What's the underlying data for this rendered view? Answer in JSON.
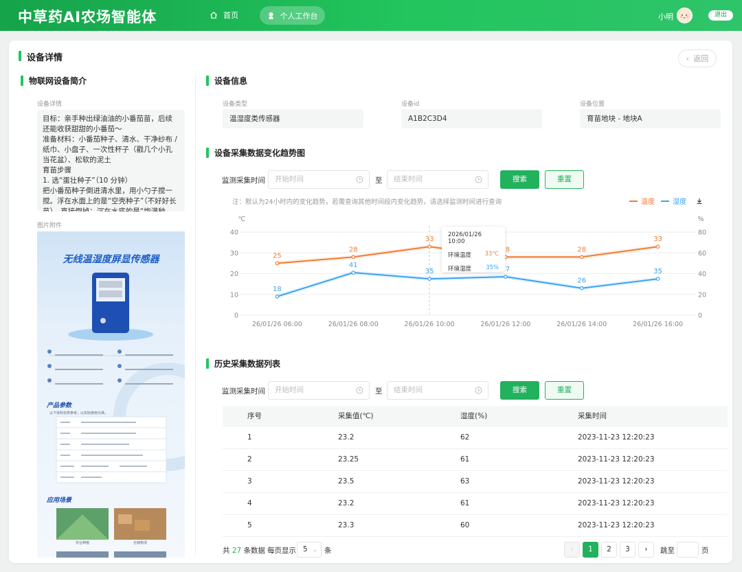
{
  "header": {
    "brand": "中草药AI农场智能体",
    "nav": {
      "home": "首页",
      "workspace": "个人工作台"
    },
    "user_name": "小明",
    "logout": "退出"
  },
  "page": {
    "title": "设备详情",
    "back": "返回"
  },
  "left": {
    "section_title": "物联网设备简介",
    "detail_label": "设备详情",
    "detail_text": "目标：亲手种出绿油油的小番茄苗，后续还能收获甜甜的小番茄～\n准备材料：小番茄种子、清水、干净纱布 / 纸巾、小盘子、一次性杯子（戳几个小孔当花盆）、松软的泥土\n育苗步骤\n1. 选“蛋壮种子”（10 分钟）\n把小番茄种子倒进清水里，用小勺子搅一搅。浮在水面上的是“空壳种子”（不好好长苗），直接倒掉；沉在水底的是“饱满种子”......",
    "attachment_label": "图片附件",
    "poster": {
      "title": "无线温湿度屏显传感器",
      "params_title": "产品参数",
      "params_sub": "以下资料仅供参考，以实际使用为准。",
      "scenes_title": "应用场景",
      "scene1": "农业种植",
      "scene2": "仓储物流"
    }
  },
  "device_info": {
    "section_title": "设备信息",
    "fields": [
      {
        "label": "设备类型",
        "value": "温湿度类传感器"
      },
      {
        "label": "设备id",
        "value": "A1B2C3D4"
      },
      {
        "label": "设备位置",
        "value": "育苗地块 - 地块A"
      }
    ]
  },
  "trend": {
    "section_title": "设备采集数据变化趋势图",
    "query_label": "监测采集时间",
    "start_placeholder": "开始时间",
    "end_placeholder": "结束时间",
    "to": "至",
    "search": "搜索",
    "reset": "重置",
    "note": "注：默认为24小时内的变化趋势，若需查询其他时间段内变化趋势，请选择监测时间进行查询",
    "tooltip": {
      "time": "2026/01/26 10:00",
      "temp_label": "环境温度",
      "temp_value": "33℃",
      "hum_label": "环境湿度",
      "hum_value": "35%"
    }
  },
  "chart_data": {
    "type": "line",
    "x": [
      "26/01/26 06:00",
      "26/01/26 08:00",
      "26/01/26 10:00",
      "26/01/26 12:00",
      "26/01/26 14:00",
      "26/01/26 16:00"
    ],
    "series": [
      {
        "name": "温度",
        "axis": "left",
        "color": "#f07c33",
        "values": [
          25,
          28,
          33,
          28,
          28,
          33
        ]
      },
      {
        "name": "湿度",
        "axis": "right",
        "color": "#3ba3ee",
        "values": [
          18,
          41,
          35,
          37,
          26,
          35
        ]
      }
    ],
    "y_left": {
      "unit": "℃",
      "ticks": [
        0,
        10,
        20,
        30,
        40
      ],
      "range": [
        0,
        40
      ]
    },
    "y_right": {
      "unit": "%",
      "ticks": [
        0,
        20,
        40,
        60,
        80
      ],
      "range": [
        0,
        80
      ]
    },
    "grid": true,
    "legend_position": "top-right"
  },
  "history": {
    "section_title": "历史采集数据列表",
    "query_label": "监测采集时间",
    "start_placeholder": "开始时间",
    "end_placeholder": "结束时间",
    "to": "至",
    "search": "搜索",
    "reset": "重置",
    "columns": [
      "序号",
      "采集值(℃)",
      "湿度(%)",
      "采集时间"
    ],
    "rows": [
      [
        "1",
        "23.2",
        "62",
        "2023-11-23 12:20:23"
      ],
      [
        "2",
        "23.25",
        "61",
        "2023-11-23 12:20:23"
      ],
      [
        "3",
        "23.5",
        "63",
        "2023-11-23 12:20:23"
      ],
      [
        "4",
        "23.2",
        "61",
        "2023-11-23 12:20:23"
      ],
      [
        "5",
        "23.3",
        "60",
        "2023-11-23 12:20:23"
      ]
    ],
    "pagination": {
      "total_prefix": "共",
      "total": "27",
      "total_suffix": "条数据",
      "per_page_label": "每页显示",
      "per_page": "5",
      "per_page_suffix": "条",
      "pages": [
        "1",
        "2",
        "3"
      ],
      "jump_label": "跳至",
      "jump_suffix": "页"
    }
  }
}
